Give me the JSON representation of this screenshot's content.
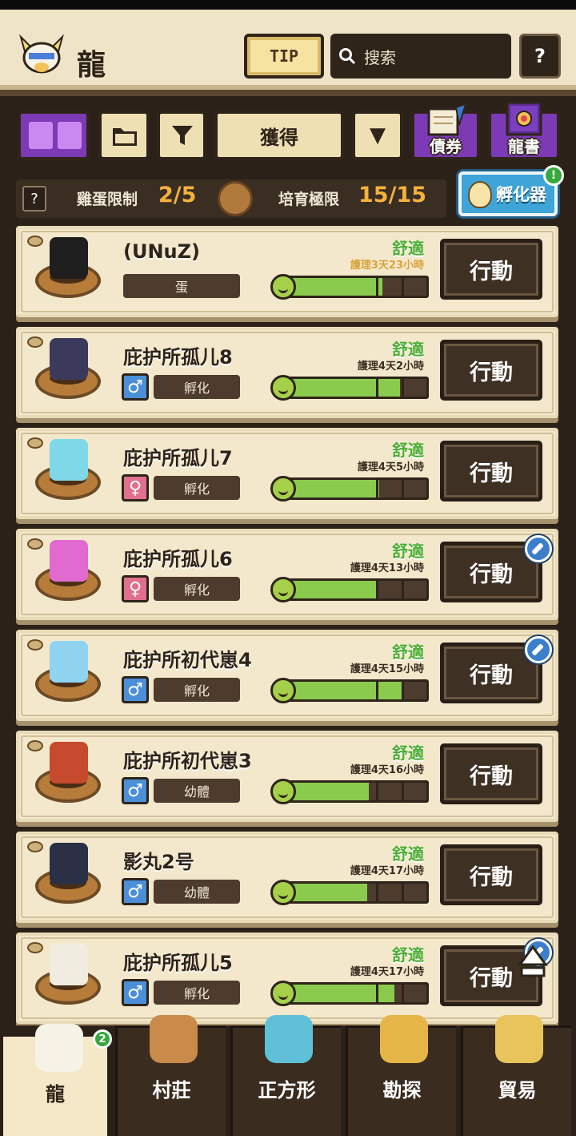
{
  "header": {
    "title": "龍",
    "tip_label": "TIP",
    "search_placeholder": "搜索",
    "help_label": "?"
  },
  "toolbar": {
    "sort_label": "獲得",
    "dropdown_symbol": "▼",
    "bond_label": "債券",
    "book_label": "龍書"
  },
  "limits": {
    "help_label": "?",
    "egg_limit_label": "雞蛋限制",
    "egg_limit_value": "2/5",
    "nurture_limit_label": "培育極限",
    "nurture_limit_value": "15/15",
    "incubator_label": "孵化器",
    "incubator_notice": "!"
  },
  "colors": {
    "accent_purple": "#7d3ab6",
    "comfort_green": "#4cae35",
    "limit_orange": "#f5b33c",
    "incubator_blue": "#3fa5d9"
  },
  "dragons": [
    {
      "name": "(UNuZ)",
      "gender": "",
      "stage": "蛋",
      "status": "舒適",
      "care": "護理3天23小時",
      "care_orange": true,
      "fill": 0.7,
      "action": "行動",
      "badge": false,
      "sprite_color": "#1f1f1f"
    },
    {
      "name": "庇护所孤儿8",
      "gender": "male",
      "stage": "孵化",
      "status": "舒適",
      "care": "護理4天2小時",
      "care_orange": false,
      "fill": 0.82,
      "action": "行動",
      "badge": false,
      "sprite_color": "#3c3a5c"
    },
    {
      "name": "庇护所孤儿7",
      "gender": "female",
      "stage": "孵化",
      "status": "舒適",
      "care": "護理4天5小時",
      "care_orange": false,
      "fill": 0.68,
      "action": "行動",
      "badge": false,
      "sprite_color": "#7fd8e8"
    },
    {
      "name": "庇护所孤儿6",
      "gender": "female",
      "stage": "孵化",
      "status": "舒適",
      "care": "護理4天13小時",
      "care_orange": false,
      "fill": 0.66,
      "action": "行動",
      "badge": true,
      "sprite_color": "#e06ad0"
    },
    {
      "name": "庇护所初代崽4",
      "gender": "male",
      "stage": "孵化",
      "status": "舒適",
      "care": "護理4天15小時",
      "care_orange": false,
      "fill": 0.84,
      "action": "行動",
      "badge": true,
      "sprite_color": "#8fd3f0"
    },
    {
      "name": "庇护所初代崽3",
      "gender": "male",
      "stage": "幼體",
      "status": "舒適",
      "care": "護理4天16小時",
      "care_orange": false,
      "fill": 0.61,
      "action": "行動",
      "badge": false,
      "sprite_color": "#c64a2e"
    },
    {
      "name": "影丸2号",
      "gender": "male",
      "stage": "幼體",
      "status": "舒適",
      "care": "護理4天17小時",
      "care_orange": false,
      "fill": 0.6,
      "action": "行動",
      "badge": false,
      "sprite_color": "#2a3046"
    },
    {
      "name": "庇护所孤儿5",
      "gender": "male",
      "stage": "孵化",
      "status": "舒適",
      "care": "護理4天17小時",
      "care_orange": false,
      "fill": 0.78,
      "action": "行動",
      "badge": true,
      "sprite_color": "#f0ece0"
    }
  ],
  "nav": {
    "badge_count": "2",
    "items": [
      {
        "label": "龍",
        "active": true
      },
      {
        "label": "村莊",
        "active": false
      },
      {
        "label": "正方形",
        "active": false
      },
      {
        "label": "勘探",
        "active": false
      },
      {
        "label": "貿易",
        "active": false
      }
    ]
  }
}
